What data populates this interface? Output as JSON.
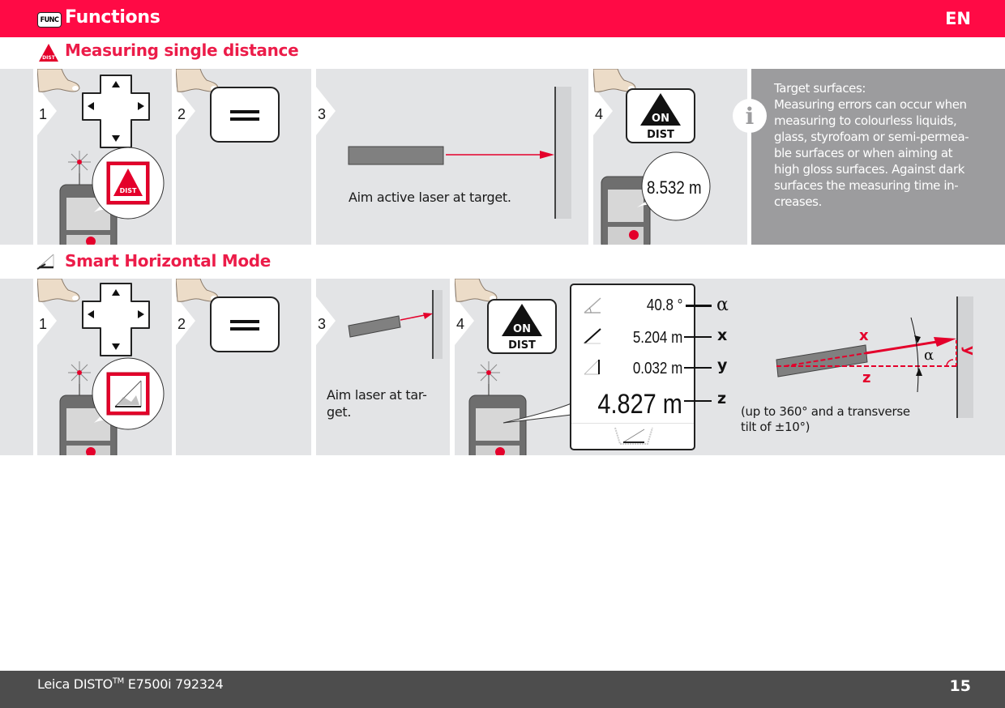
{
  "header": {
    "func_icon_label": "FUNC",
    "title": "Functions",
    "language": "EN"
  },
  "sections": [
    {
      "title": "Measuring single distance",
      "icon": "dist-triangle-icon",
      "steps": [
        {
          "number": "1",
          "button": "dpad-key",
          "display_icon": "dist-triangle-icon",
          "display_label": "DIST"
        },
        {
          "number": "2",
          "button": "equals-key"
        },
        {
          "number": "3",
          "caption": "Aim active laser at target."
        },
        {
          "number": "4",
          "button_line1": "ON",
          "button_line2": "DIST",
          "readout": "8.532 m"
        }
      ],
      "info": {
        "icon": "info-icon",
        "icon_glyph": "i",
        "text_lines": [
          "Target surfaces:",
          "Measuring errors  can occur when",
          "measuring to colourless liquids,",
          "glass, styrofoam or semi-permea-",
          "ble surfaces or when aiming at",
          "high gloss surfaces. Against dark",
          "surfaces the measuring time in-",
          "creases."
        ]
      }
    },
    {
      "title": "Smart Horizontal Mode",
      "icon": "smart-horizontal-icon",
      "steps": [
        {
          "number": "1",
          "button": "dpad-key",
          "display_icon": "smart-horizontal-icon"
        },
        {
          "number": "2",
          "button": "equals-key"
        },
        {
          "number": "3",
          "caption_lines": [
            "Aim laser at tar-",
            "get."
          ]
        },
        {
          "number": "4",
          "button_line1": "ON",
          "button_line2": "DIST",
          "display": {
            "angle": "40.8 °",
            "slope_distance": "5.204 m",
            "height": "0.032 m",
            "horizontal_distance": "4.827 m"
          },
          "labels": {
            "angle": "α",
            "x": "x",
            "y": "y",
            "z": "z"
          }
        }
      ],
      "diagram": {
        "labels": {
          "x": "x",
          "y": "y",
          "z": "z",
          "alpha": "α"
        },
        "caption_lines": [
          "(up to 360° and a transverse",
          "tilt of ±10°)"
        ]
      }
    }
  ],
  "footer": {
    "product": "Leica DISTO",
    "trademark": "TM",
    "model": " E7500i 792324",
    "page_number": "15"
  },
  "colors": {
    "brand_red": "#ff0a45",
    "section_red": "#ec1c49",
    "panel_gray": "#e3e4e6",
    "info_gray": "#9c9c9e",
    "footer_gray": "#4d4d4d"
  }
}
